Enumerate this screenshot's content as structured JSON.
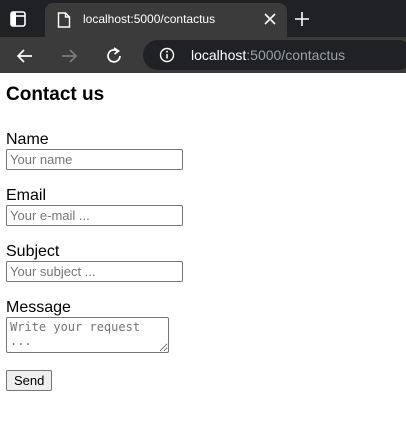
{
  "browser": {
    "tab": {
      "title": "localhost:5000/contactus"
    },
    "address_bar": {
      "host": "localhost",
      "rest": ":5000/contactus"
    }
  },
  "page": {
    "heading": "Contact us",
    "fields": {
      "name": {
        "label": "Name",
        "placeholder": "Your name",
        "value": ""
      },
      "email": {
        "label": "Email",
        "placeholder": "Your e-mail ...",
        "value": ""
      },
      "subject": {
        "label": "Subject",
        "placeholder": "Your subject ...",
        "value": ""
      },
      "message": {
        "label": "Message",
        "placeholder": "Write your request ...",
        "value": ""
      }
    },
    "send_label": "Send"
  },
  "icons": {
    "tab_actions": "tab-actions-icon",
    "favicon": "page-icon",
    "tab_close": "close-icon",
    "new_tab": "plus-icon",
    "back": "arrow-left-icon",
    "forward": "arrow-right-icon",
    "reload": "reload-icon",
    "site_info": "info-icon"
  }
}
